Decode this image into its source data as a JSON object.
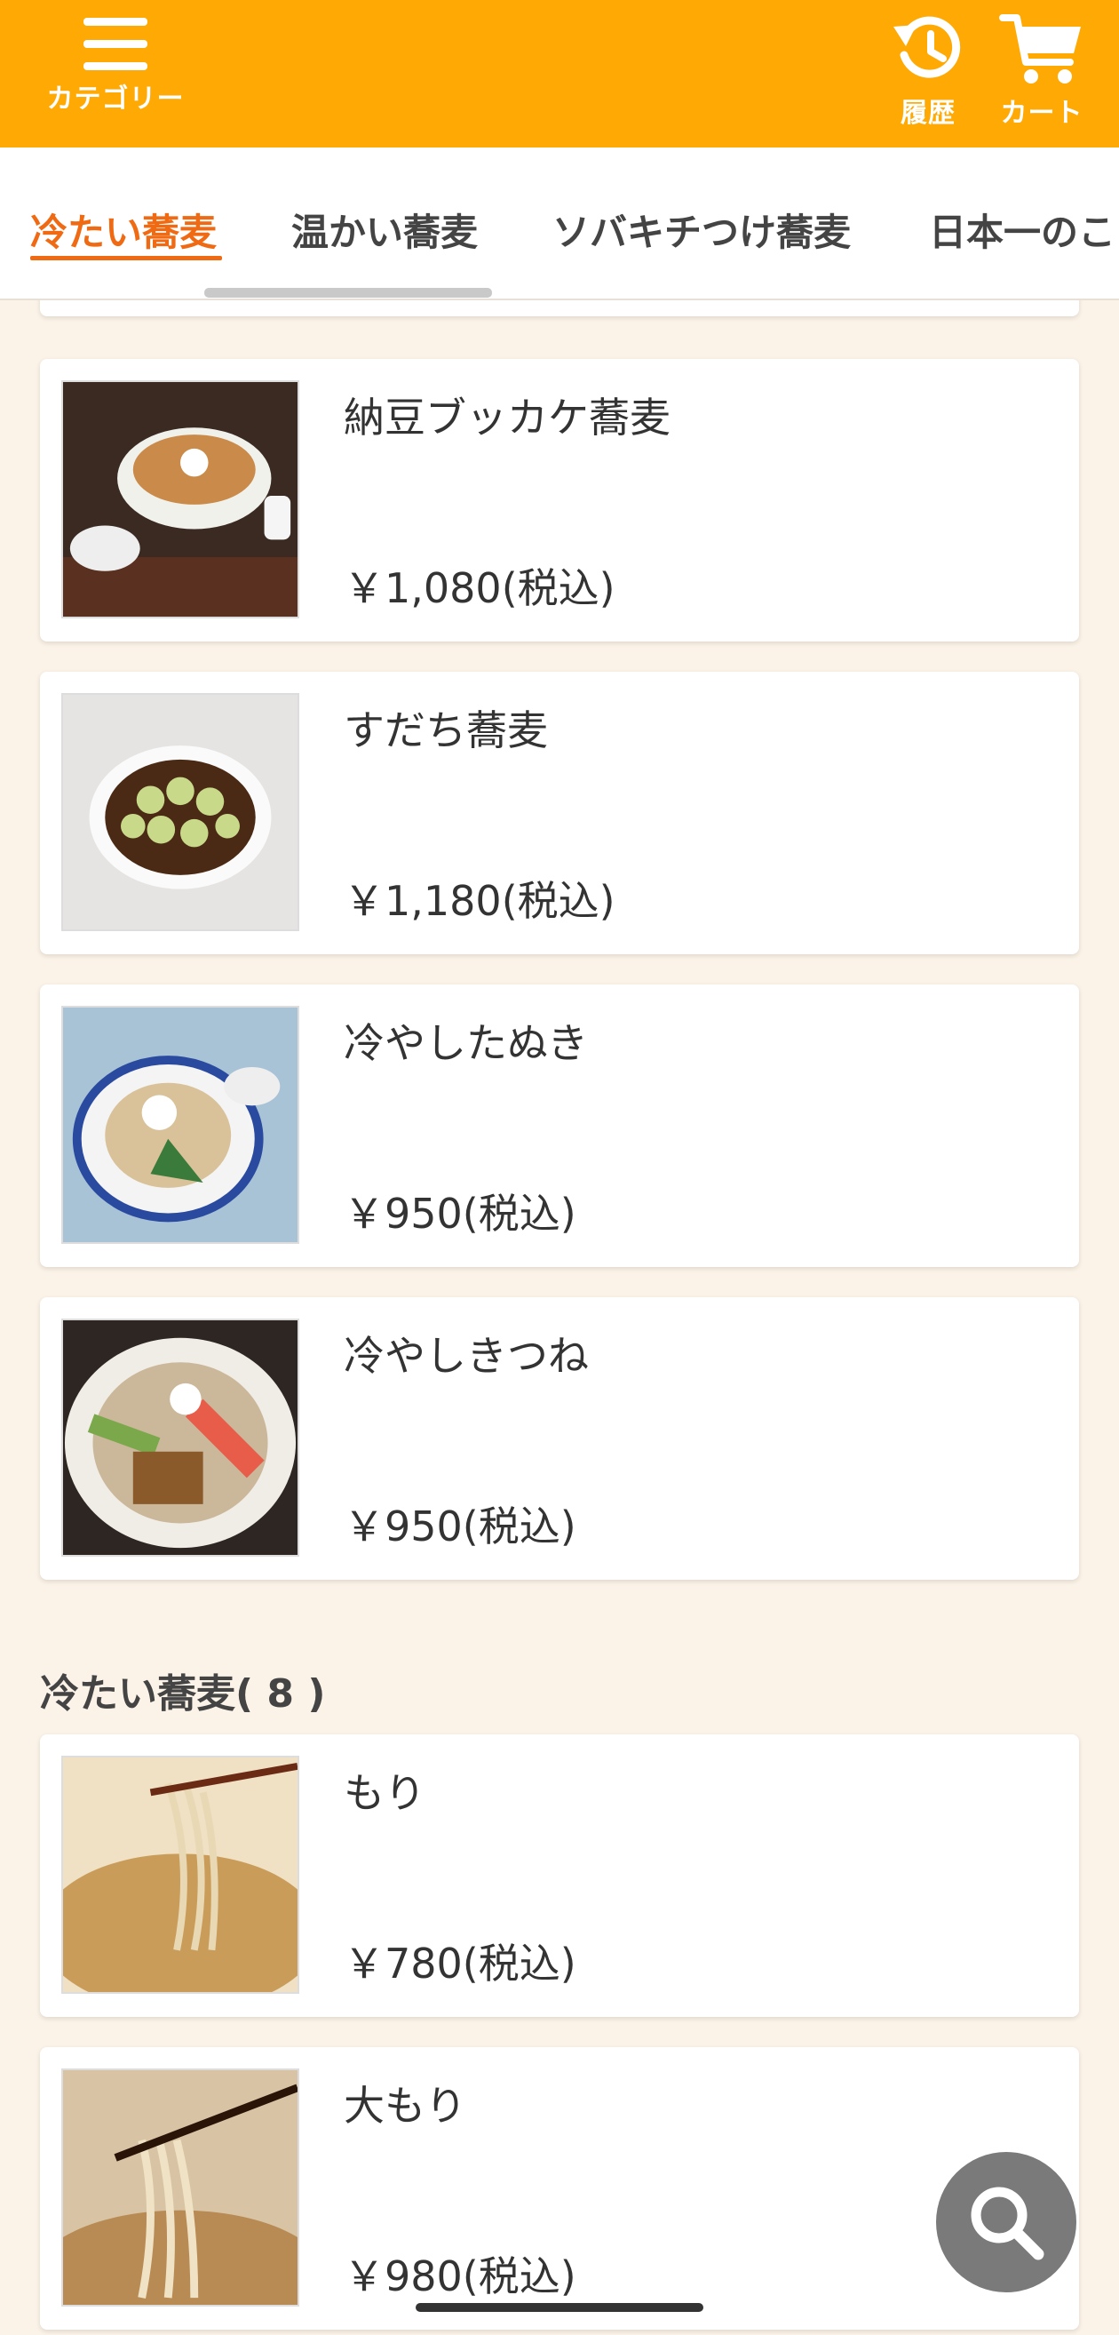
{
  "header": {
    "category_label": "カテゴリー",
    "history_label": "履歴",
    "cart_label": "カート",
    "background_color": "#ffa904"
  },
  "tabs": [
    {
      "label": "冷たい蕎麦",
      "active": true
    },
    {
      "label": "温かい蕎麦",
      "active": false
    },
    {
      "label": "ソバキチつけ蕎麦",
      "active": false
    },
    {
      "label": "日本一のこ",
      "active": false
    }
  ],
  "accent_color": "#ef6a12",
  "items": [
    {
      "name": "納豆ブッカケ蕎麦",
      "price": "￥1,080(税込)",
      "image": "natto-bukkake-soba-photo"
    },
    {
      "name": "すだち蕎麦",
      "price": "￥1,180(税込)",
      "image": "sudachi-soba-photo"
    },
    {
      "name": "冷やしたぬき",
      "price": "￥950(税込)",
      "image": "hiyashi-tanuki-photo"
    },
    {
      "name": "冷やしきつね",
      "price": "￥950(税込)",
      "image": "hiyashi-kitsune-photo"
    }
  ],
  "section": {
    "title": "冷たい蕎麦( 8 )",
    "items": [
      {
        "name": "もり",
        "price": "￥780(税込)",
        "image": "mori-soba-photo"
      },
      {
        "name": "大もり",
        "price": "￥980(税込)",
        "image": "oomori-soba-photo"
      }
    ]
  },
  "search_fab_icon": "search-icon"
}
